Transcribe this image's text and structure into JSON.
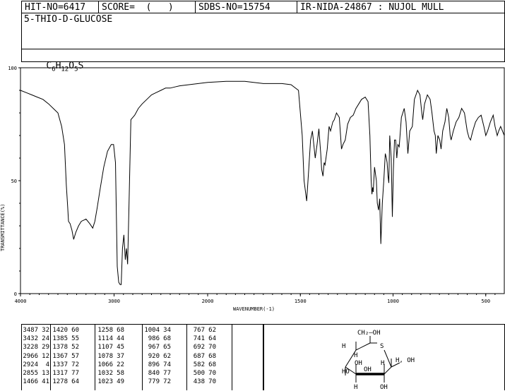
{
  "header": {
    "hit_no": "HIT-NO=6417",
    "score": "SCORE=  (   )",
    "sdbs_no": "SDBS-NO=15754",
    "ir_nida": "IR-NIDA-24867 : NUJOL MULL"
  },
  "compound_name": "5-THIO-D-GLUCOSE",
  "formula": {
    "c": "C",
    "n6": "6",
    "h": "H",
    "n12": "12",
    "o": "O",
    "n5": "5",
    "s": "S"
  },
  "chart_data": {
    "type": "line",
    "xlabel": "WAVENUMBER(-1)",
    "ylabel": "TRANSMITTANCE(%)",
    "xlim": [
      4000,
      400
    ],
    "ylim": [
      0,
      100
    ],
    "x_ticks": [
      "4000",
      "3000",
      "2000",
      "1500",
      "1000",
      "500"
    ],
    "y_ticks": [
      "100",
      "50",
      "0"
    ],
    "spectrum": [
      [
        4000,
        90
      ],
      [
        3940,
        89
      ],
      [
        3880,
        88
      ],
      [
        3820,
        87
      ],
      [
        3760,
        86
      ],
      [
        3700,
        84
      ],
      [
        3650,
        82
      ],
      [
        3600,
        80
      ],
      [
        3560,
        74
      ],
      [
        3530,
        66
      ],
      [
        3510,
        48
      ],
      [
        3495,
        38
      ],
      [
        3487,
        32
      ],
      [
        3470,
        31
      ],
      [
        3450,
        28
      ],
      [
        3432,
        24
      ],
      [
        3410,
        27
      ],
      [
        3380,
        30
      ],
      [
        3350,
        32
      ],
      [
        3300,
        33
      ],
      [
        3260,
        31
      ],
      [
        3228,
        29
      ],
      [
        3205,
        32
      ],
      [
        3180,
        38
      ],
      [
        3150,
        46
      ],
      [
        3110,
        56
      ],
      [
        3070,
        63
      ],
      [
        3030,
        66
      ],
      [
        3005,
        66
      ],
      [
        2985,
        58
      ],
      [
        2966,
        12
      ],
      [
        2950,
        5
      ],
      [
        2935,
        4
      ],
      [
        2924,
        4
      ],
      [
        2910,
        20
      ],
      [
        2895,
        26
      ],
      [
        2880,
        15
      ],
      [
        2868,
        20
      ],
      [
        2855,
        13
      ],
      [
        2840,
        40
      ],
      [
        2820,
        77
      ],
      [
        2780,
        79
      ],
      [
        2740,
        82
      ],
      [
        2700,
        84
      ],
      [
        2650,
        86
      ],
      [
        2600,
        88
      ],
      [
        2550,
        89
      ],
      [
        2500,
        90
      ],
      [
        2450,
        91
      ],
      [
        2400,
        91
      ],
      [
        2350,
        91.5
      ],
      [
        2300,
        92
      ],
      [
        2200,
        92.5
      ],
      [
        2100,
        93
      ],
      [
        2000,
        93.5
      ],
      [
        1900,
        94
      ],
      [
        1800,
        94
      ],
      [
        1700,
        93
      ],
      [
        1600,
        93
      ],
      [
        1550,
        92.5
      ],
      [
        1510,
        90
      ],
      [
        1490,
        70
      ],
      [
        1480,
        50
      ],
      [
        1466,
        41
      ],
      [
        1455,
        55
      ],
      [
        1445,
        68
      ],
      [
        1435,
        72
      ],
      [
        1420,
        60
      ],
      [
        1410,
        66
      ],
      [
        1400,
        73
      ],
      [
        1390,
        62
      ],
      [
        1385,
        55
      ],
      [
        1378,
        52
      ],
      [
        1372,
        58
      ],
      [
        1367,
        57
      ],
      [
        1355,
        64
      ],
      [
        1345,
        74
      ],
      [
        1337,
        72
      ],
      [
        1325,
        76
      ],
      [
        1317,
        77
      ],
      [
        1305,
        80
      ],
      [
        1290,
        78
      ],
      [
        1278,
        64
      ],
      [
        1270,
        66
      ],
      [
        1258,
        68
      ],
      [
        1245,
        75
      ],
      [
        1230,
        78
      ],
      [
        1215,
        79
      ],
      [
        1200,
        82
      ],
      [
        1170,
        86
      ],
      [
        1150,
        87
      ],
      [
        1135,
        85
      ],
      [
        1125,
        70
      ],
      [
        1118,
        50
      ],
      [
        1114,
        44
      ],
      [
        1110,
        47
      ],
      [
        1107,
        45
      ],
      [
        1100,
        56
      ],
      [
        1090,
        50
      ],
      [
        1085,
        40
      ],
      [
        1078,
        37
      ],
      [
        1072,
        42
      ],
      [
        1066,
        22
      ],
      [
        1058,
        40
      ],
      [
        1050,
        50
      ],
      [
        1042,
        62
      ],
      [
        1036,
        60
      ],
      [
        1032,
        58
      ],
      [
        1027,
        52
      ],
      [
        1023,
        49
      ],
      [
        1018,
        70
      ],
      [
        1010,
        60
      ],
      [
        1004,
        34
      ],
      [
        998,
        55
      ],
      [
        992,
        68
      ],
      [
        986,
        68
      ],
      [
        980,
        60
      ],
      [
        974,
        66
      ],
      [
        967,
        65
      ],
      [
        955,
        78
      ],
      [
        940,
        82
      ],
      [
        930,
        76
      ],
      [
        920,
        62
      ],
      [
        910,
        72
      ],
      [
        896,
        74
      ],
      [
        885,
        86
      ],
      [
        868,
        90
      ],
      [
        855,
        88
      ],
      [
        845,
        80
      ],
      [
        840,
        77
      ],
      [
        830,
        84
      ],
      [
        815,
        88
      ],
      [
        800,
        86
      ],
      [
        790,
        80
      ],
      [
        779,
        72
      ],
      [
        772,
        70
      ],
      [
        767,
        62
      ],
      [
        758,
        70
      ],
      [
        748,
        68
      ],
      [
        741,
        64
      ],
      [
        732,
        72
      ],
      [
        720,
        76
      ],
      [
        710,
        82
      ],
      [
        700,
        78
      ],
      [
        692,
        70
      ],
      [
        687,
        68
      ],
      [
        675,
        72
      ],
      [
        660,
        76
      ],
      [
        645,
        78
      ],
      [
        630,
        82
      ],
      [
        615,
        80
      ],
      [
        600,
        72
      ],
      [
        590,
        69
      ],
      [
        582,
        68
      ],
      [
        570,
        72
      ],
      [
        555,
        76
      ],
      [
        540,
        78
      ],
      [
        525,
        79
      ],
      [
        510,
        74
      ],
      [
        500,
        70
      ],
      [
        490,
        72
      ],
      [
        475,
        76
      ],
      [
        460,
        79
      ],
      [
        450,
        74
      ],
      [
        438,
        70
      ],
      [
        430,
        72
      ],
      [
        420,
        74
      ],
      [
        410,
        72
      ],
      [
        400,
        70
      ]
    ],
    "peak_table": [
      {
        "wn": "3487",
        "t": "32"
      },
      {
        "wn": "3432",
        "t": "24"
      },
      {
        "wn": "3228",
        "t": "29"
      },
      {
        "wn": "2966",
        "t": "12"
      },
      {
        "wn": "2924",
        "t": "4"
      },
      {
        "wn": "2855",
        "t": "13"
      },
      {
        "wn": "1466",
        "t": "41"
      },
      {
        "wn": "1420",
        "t": "60"
      },
      {
        "wn": "1385",
        "t": "55"
      },
      {
        "wn": "1378",
        "t": "52"
      },
      {
        "wn": "1367",
        "t": "57"
      },
      {
        "wn": "1337",
        "t": "72"
      },
      {
        "wn": "1317",
        "t": "77"
      },
      {
        "wn": "1278",
        "t": "64"
      },
      {
        "wn": "1258",
        "t": "68"
      },
      {
        "wn": "1114",
        "t": "44"
      },
      {
        "wn": "1107",
        "t": "45"
      },
      {
        "wn": "1078",
        "t": "37"
      },
      {
        "wn": "1066",
        "t": "22"
      },
      {
        "wn": "1032",
        "t": "58"
      },
      {
        "wn": "1023",
        "t": "49"
      },
      {
        "wn": "1004",
        "t": "34"
      },
      {
        "wn": "986",
        "t": "68"
      },
      {
        "wn": "967",
        "t": "65"
      },
      {
        "wn": "920",
        "t": "62"
      },
      {
        "wn": "896",
        "t": "74"
      },
      {
        "wn": "840",
        "t": "77"
      },
      {
        "wn": "779",
        "t": "72"
      },
      {
        "wn": "767",
        "t": "62"
      },
      {
        "wn": "741",
        "t": "64"
      },
      {
        "wn": "692",
        "t": "70"
      },
      {
        "wn": "687",
        "t": "68"
      },
      {
        "wn": "582",
        "t": "68"
      },
      {
        "wn": "500",
        "t": "70"
      },
      {
        "wn": "438",
        "t": "70"
      }
    ]
  },
  "structure": {
    "ch2oh": "CH₂—OH",
    "h_left_top": "H",
    "h_inner": "H",
    "s": "S",
    "oh_left": "OH",
    "h_oh_right": "H, OH",
    "ho": "HO",
    "h_mid": "H",
    "oh_mid": "OH",
    "h_bottom": "H",
    "oh_bottom": "OH"
  }
}
